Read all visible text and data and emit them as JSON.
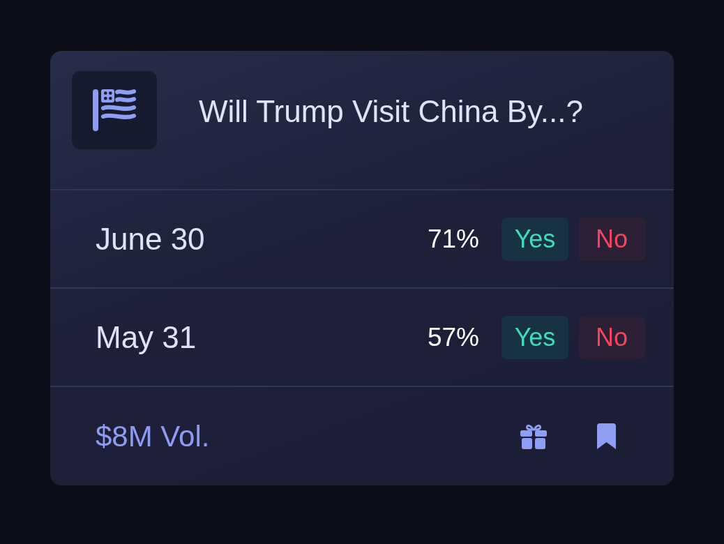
{
  "market": {
    "title": "Will Trump Visit China By...?"
  },
  "outcomes": [
    {
      "label": "June 30",
      "chance": "71%",
      "yes": "Yes",
      "no": "No"
    },
    {
      "label": "May 31",
      "chance": "57%",
      "yes": "Yes",
      "no": "No"
    }
  ],
  "footer": {
    "volume": "$8M Vol."
  }
}
